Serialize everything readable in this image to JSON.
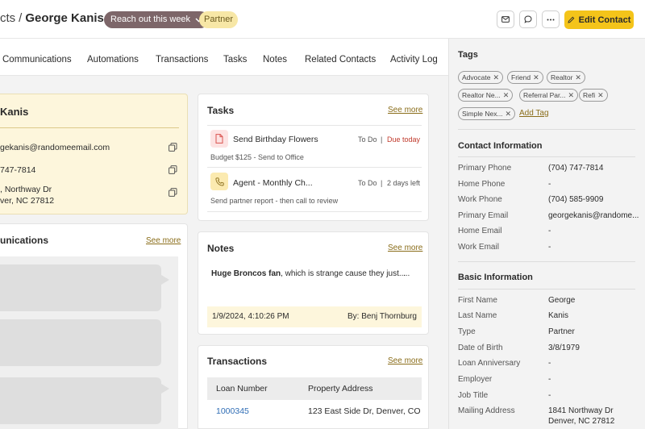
{
  "header": {
    "breadcrumb_prev": "cts",
    "breadcrumb_sep": "/",
    "contact_name": "George Kanis",
    "reach_out_label": "Reach out this week",
    "type_badge": "Partner",
    "edit_label": "Edit Contact"
  },
  "tabs": [
    {
      "label": "Communications"
    },
    {
      "label": "Automations"
    },
    {
      "label": "Transactions"
    },
    {
      "label": "Tasks"
    },
    {
      "label": "Notes"
    },
    {
      "label": "Related Contacts"
    },
    {
      "label": "Activity Log"
    }
  ],
  "contact_card": {
    "name": "Kanis",
    "email": "gekanis@randomeemail.com",
    "phone": "747-7814",
    "address_line1": ", Northway Dr",
    "address_line2": "ver, NC 27812"
  },
  "communications": {
    "title": "unications",
    "see_more": "See more"
  },
  "tasks": {
    "title": "Tasks",
    "see_more": "See more",
    "items": [
      {
        "title": "Send Birthday Flowers",
        "status": "To Do",
        "due": "Due today",
        "sub": "Budget $125 - Send to Office"
      },
      {
        "title": "Agent - Monthly Ch...",
        "status": "To Do",
        "due": "2 days left",
        "sub": "Send partner report - then call to review"
      }
    ],
    "divider": "|"
  },
  "notes": {
    "title": "Notes",
    "see_more": "See more",
    "note_bold": "Huge Broncos fan",
    "note_rest": ", which is strange cause they just...",
    "ellipsis": "...",
    "date": "1/9/2024, 4:10:26 PM",
    "author": "By: Benj Thornburg"
  },
  "transactions": {
    "title": "Transactions",
    "see_more": "See more",
    "columns": [
      "Loan Number",
      "Property Address"
    ],
    "rows": [
      {
        "loan": "1000345",
        "address": "123 East Side Dr, Denver, CO"
      }
    ]
  },
  "sidebar": {
    "tags_title": "Tags",
    "tags": [
      "Advocate",
      "Friend",
      "Realtor",
      "Realtor Ne...",
      "Referral Par...",
      "Refi",
      "Simple Nex..."
    ],
    "add_tag": "Add Tag",
    "contact_info_title": "Contact Information",
    "contact_info": [
      {
        "label": "Primary Phone",
        "value": "(704) 747-7814"
      },
      {
        "label": "Home Phone",
        "value": "-"
      },
      {
        "label": "Work Phone",
        "value": "(704) 585-9909"
      },
      {
        "label": "Primary Email",
        "value": "georgekanis@randome..."
      },
      {
        "label": "Home Email",
        "value": "-"
      },
      {
        "label": "Work Email",
        "value": "-"
      }
    ],
    "basic_info_title": "Basic Information",
    "basic_info": [
      {
        "label": "First Name",
        "value": "George"
      },
      {
        "label": "Last Name",
        "value": "Kanis"
      },
      {
        "label": "Type",
        "value": "Partner"
      },
      {
        "label": "Date of Birth",
        "value": "3/8/1979"
      },
      {
        "label": "Loan Anniversary",
        "value": "-"
      },
      {
        "label": "Employer",
        "value": "-"
      },
      {
        "label": "Job Title",
        "value": "-"
      },
      {
        "label": "Mailing Address",
        "value": "1841 Northway Dr",
        "value2": "Denver, NC 27812"
      }
    ]
  },
  "colors": {
    "accent": "#f4c41a",
    "reach_pill": "#7d6669",
    "partner_badge": "#f7e7a6",
    "due_today": "#c0392b",
    "link": "#8a6d1a",
    "tx_link": "#2f6db5"
  },
  "icons": [
    "chevron-down-icon",
    "mail-icon",
    "chat-icon",
    "more-icon",
    "pencil-icon",
    "copy-icon",
    "document-icon",
    "phone-icon",
    "close-icon"
  ]
}
